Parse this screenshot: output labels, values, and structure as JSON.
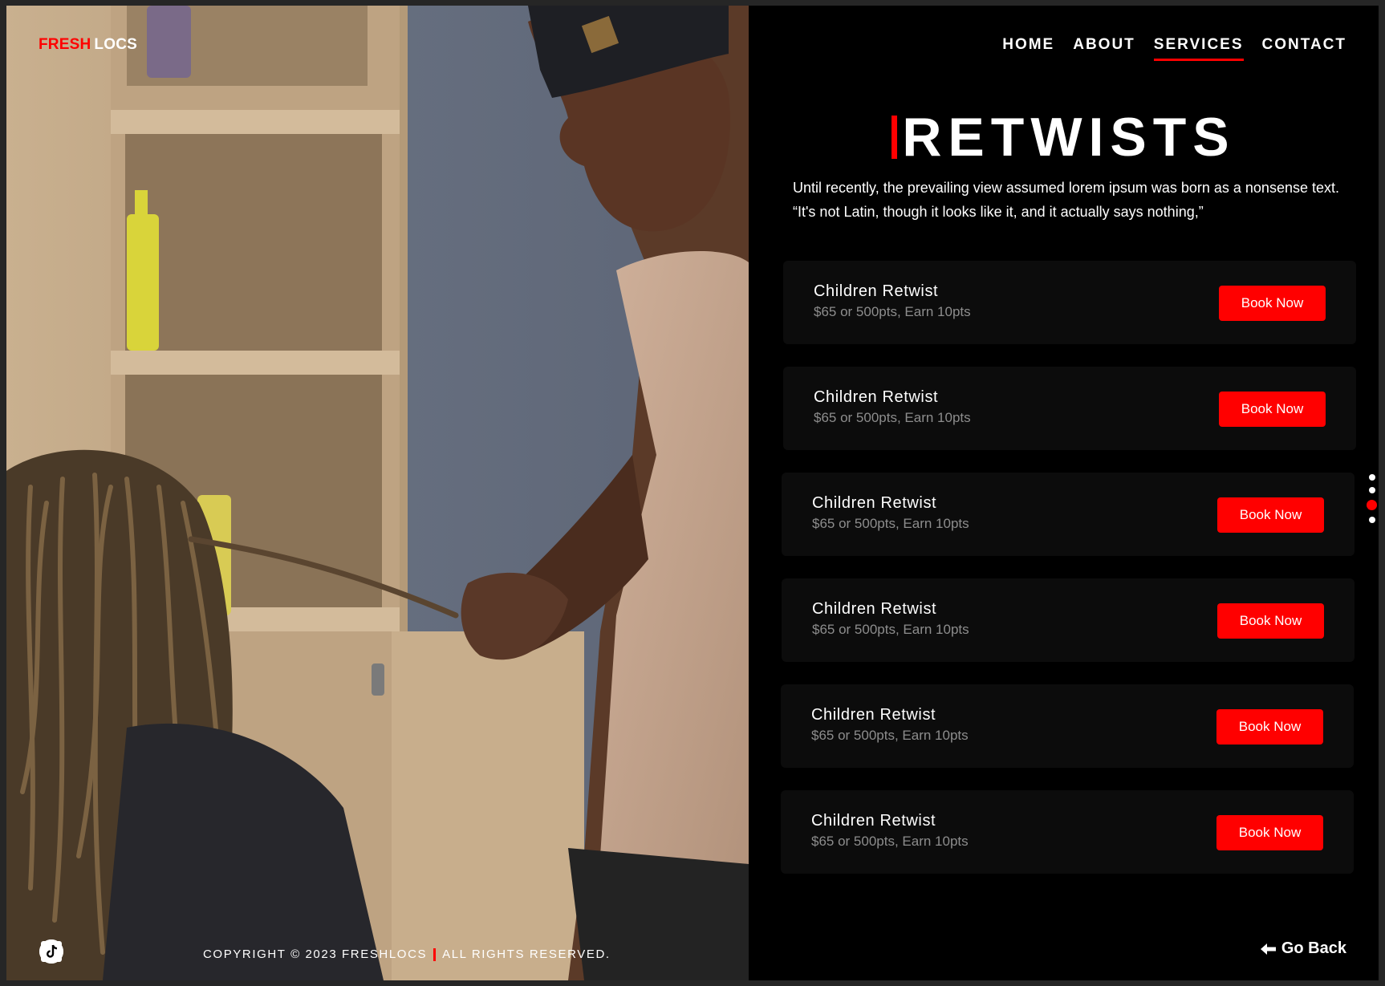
{
  "brand": {
    "fresh": "FRESH",
    "locs": "LOCS"
  },
  "nav": {
    "items": [
      {
        "label": "HOME"
      },
      {
        "label": "ABOUT"
      },
      {
        "label": "SERVICES"
      },
      {
        "label": "CONTACT"
      }
    ],
    "active": "SERVICES"
  },
  "page": {
    "title": "RETWISTS",
    "intro": "Until recently, the prevailing view assumed lorem ipsum was born as a nonsense text. “It's not Latin, though it looks like it, and it actually says nothing,”"
  },
  "services": [
    {
      "name": "Children Retwist",
      "price": "$65 or 500pts, Earn 10pts",
      "button": "Book Now"
    },
    {
      "name": "Children Retwist",
      "price": "$65 or 500pts, Earn 10pts",
      "button": "Book Now"
    },
    {
      "name": "Children Retwist",
      "price": "$65 or 500pts, Earn 10pts",
      "button": "Book Now"
    },
    {
      "name": "Children Retwist",
      "price": "$65 or 500pts, Earn 10pts",
      "button": "Book Now"
    },
    {
      "name": "Children Retwist",
      "price": "$65 or 500pts, Earn 10pts",
      "button": "Book Now"
    },
    {
      "name": "Children Retwist",
      "price": "$65 or 500pts, Earn 10pts",
      "button": "Book Now"
    }
  ],
  "pagination": {
    "total": 4,
    "active_index": 2
  },
  "footer": {
    "copyright_left": "COPYRIGHT © 2023 FRESHLOCS",
    "copyright_right": "ALL RIGHTS RESERVED.",
    "social_icons": [
      "instagram-icon",
      "facebook-icon",
      "tiktok-icon"
    ]
  },
  "back": {
    "label": "Go Back",
    "icon": "arrow-left-icon"
  },
  "colors": {
    "accent": "#ff0000",
    "background": "#000000",
    "card": "#0c0c0c",
    "muted_text": "#8d8d8d"
  }
}
